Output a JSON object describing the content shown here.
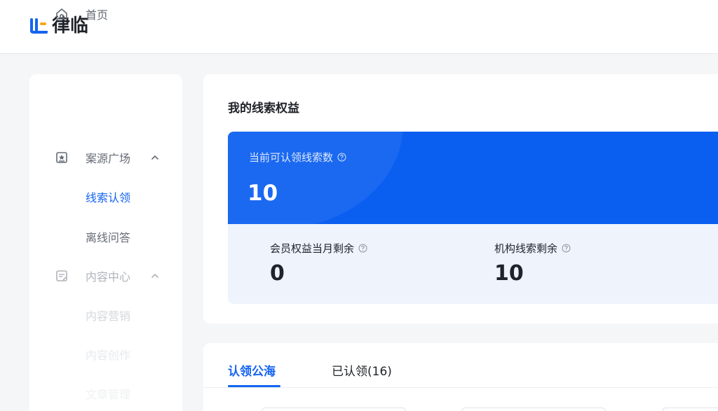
{
  "app": {
    "brand_name": "律临",
    "brand_color": "#1464f0"
  },
  "sidebar": {
    "items": [
      {
        "label": "首页",
        "icon": "home-icon"
      },
      {
        "label": "案源广场",
        "icon": "star-doc-icon",
        "expanded": true
      },
      {
        "label": "线索认领",
        "active": true
      },
      {
        "label": "离线问答"
      },
      {
        "label": "内容中心",
        "icon": "edit-doc-icon",
        "expanded": true
      },
      {
        "label": "内容营销"
      },
      {
        "label": "内容创作"
      },
      {
        "label": "文章管理"
      }
    ]
  },
  "clues": {
    "title": "我的线索权益",
    "claimable_label": "当前可认领线索数",
    "claimable_value": "10",
    "member_label": "会员权益当月剩余",
    "member_value": "0",
    "org_label": "机构线索剩余",
    "org_value": "10"
  },
  "tabs": [
    {
      "label": "认领公海",
      "active": true
    },
    {
      "label": "已认领(16)",
      "active": false
    }
  ]
}
